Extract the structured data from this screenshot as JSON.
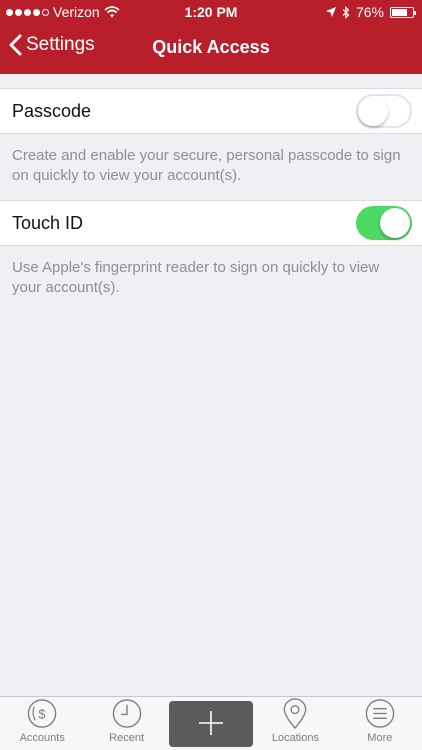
{
  "status_bar": {
    "carrier": "Verizon",
    "time": "1:20 PM",
    "battery_percent": "76%",
    "battery_level": 0.76,
    "signal_dots_filled": 4,
    "icons": [
      "wifi-icon",
      "location-arrow-icon",
      "bluetooth-icon",
      "battery-icon"
    ]
  },
  "nav": {
    "back_label": "Settings",
    "title": "Quick Access"
  },
  "settings": {
    "passcode": {
      "label": "Passcode",
      "enabled": false,
      "description": "Create and enable your secure, personal passcode to sign on quickly to view your account(s)."
    },
    "touch_id": {
      "label": "Touch ID",
      "enabled": true,
      "description": "Use Apple's fingerprint reader to sign on quickly to view your account(s)."
    }
  },
  "tabbar": {
    "items": [
      {
        "label": "Accounts",
        "icon": "dollar-coin-icon"
      },
      {
        "label": "Recent",
        "icon": "clock-icon"
      },
      {
        "label": "",
        "icon": "plus-icon"
      },
      {
        "label": "Locations",
        "icon": "map-pin-icon"
      },
      {
        "label": "More",
        "icon": "menu-lines-icon"
      }
    ]
  },
  "colors": {
    "header": "#b81f2b",
    "toggle_on": "#4cd964",
    "background": "#efeff4"
  }
}
